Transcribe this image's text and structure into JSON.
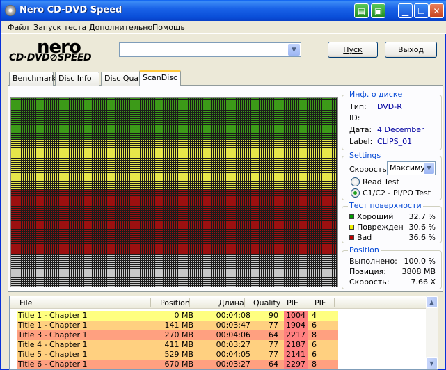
{
  "window": {
    "title": "Nero CD-DVD Speed"
  },
  "menu": [
    {
      "label": "Файл",
      "u": "Ф",
      "rest": "айл"
    },
    {
      "label": "Запуск теста",
      "u": "З",
      "rest": "апуск теста"
    },
    {
      "label": "Дополнительно",
      "u": "Д",
      "rest": "ополнительно"
    },
    {
      "label": "Помощь",
      "u": "П",
      "rest": "омощь"
    }
  ],
  "logo": {
    "brand": "nero",
    "product": "CD·DVD⊘SPEED"
  },
  "drive": {
    "selected": ""
  },
  "buttons": {
    "start": "Пуск",
    "exit": "Выход"
  },
  "tabs": [
    "Benchmark",
    "Disc Info",
    "Disc Quality",
    "ScanDisc"
  ],
  "active_tab": "ScanDisc",
  "disc_info": {
    "title": "Инф. о диске",
    "type_label": "Тип:",
    "type_value": "DVD-R",
    "id_label": "ID:",
    "id_value": "",
    "date_label": "Дата:",
    "date_value": "4 December",
    "label_label": "Label:",
    "label_value": "CLIPS_01"
  },
  "settings": {
    "title": "Settings",
    "speed_label": "Скорость",
    "speed_value": "Максиму",
    "options": [
      {
        "label": "Read Test",
        "selected": false
      },
      {
        "label": "C1/C2 - PI/PO Test",
        "selected": true
      }
    ]
  },
  "surface": {
    "title": "Тест поверхности",
    "items": [
      {
        "label": "Хороший",
        "value": "32.7 %",
        "color": "#00a000"
      },
      {
        "label": "Поврежден",
        "value": "30.6 %",
        "color": "#f0f000"
      },
      {
        "label": "Bad",
        "value": "36.6 %",
        "color": "#c00000"
      }
    ]
  },
  "position": {
    "title": "Position",
    "done_label": "Выполнено:",
    "done_value": "100.0 %",
    "pos_label": "Позиция:",
    "pos_value": "3808 MB",
    "speed_label": "Скорость:",
    "speed_value": "7.66 X"
  },
  "scan_grid": {
    "green_fraction": 0.22,
    "yellow_fraction": 0.26,
    "red_fraction": 0.34,
    "colors": {
      "good": "#3c9a18",
      "damaged": "#e6e64a",
      "bad": "#9c1010",
      "unread": "#c8c8c8"
    }
  },
  "list": {
    "columns": [
      "File",
      "Position",
      "Длина",
      "Quality",
      "PIE",
      "PIF"
    ],
    "rows": [
      {
        "file": "Title 1 - Chapter 1",
        "position": "0 MB",
        "length": "00:04:08",
        "quality": "90",
        "pie": "1004",
        "pif": "4",
        "bg": "#ffff80"
      },
      {
        "file": "Title 1 - Chapter 1",
        "position": "141 MB",
        "length": "00:03:47",
        "quality": "77",
        "pie": "1904",
        "pif": "6",
        "bg": "#ffd080"
      },
      {
        "file": "Title 3 - Chapter 1",
        "position": "270 MB",
        "length": "00:04:06",
        "quality": "64",
        "pie": "2217",
        "pif": "8",
        "bg": "#ffa080"
      },
      {
        "file": "Title 4 - Chapter 1",
        "position": "411 MB",
        "length": "00:03:27",
        "quality": "77",
        "pie": "2187",
        "pif": "6",
        "bg": "#ffd080"
      },
      {
        "file": "Title 5 - Chapter 1",
        "position": "529 MB",
        "length": "00:04:05",
        "quality": "77",
        "pie": "2141",
        "pif": "6",
        "bg": "#ffd080"
      },
      {
        "file": "Title 6 - Chapter 1",
        "position": "670 MB",
        "length": "00:03:27",
        "quality": "64",
        "pie": "2297",
        "pif": "8",
        "bg": "#ffa080"
      }
    ]
  }
}
